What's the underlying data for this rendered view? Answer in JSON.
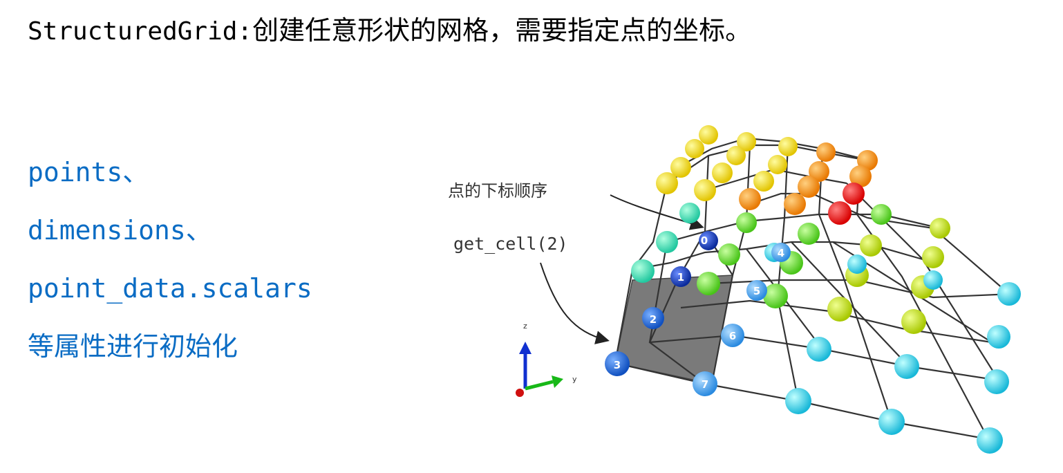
{
  "title": {
    "class_name": "StructuredGrid:",
    "description": "创建任意形状的网格，需要指定点的坐标。"
  },
  "attributes": {
    "items": [
      "points、",
      "dimensions、",
      "point_data.scalars"
    ],
    "summary": "等属性进行初始化"
  },
  "figure": {
    "label_point_order": "点的下标顺序",
    "label_get_cell": "get_cell(2)",
    "axis_z": "z",
    "axis_y": "y",
    "point_indices": [
      "0",
      "1",
      "2",
      "3",
      "4",
      "5",
      "6",
      "7"
    ]
  }
}
